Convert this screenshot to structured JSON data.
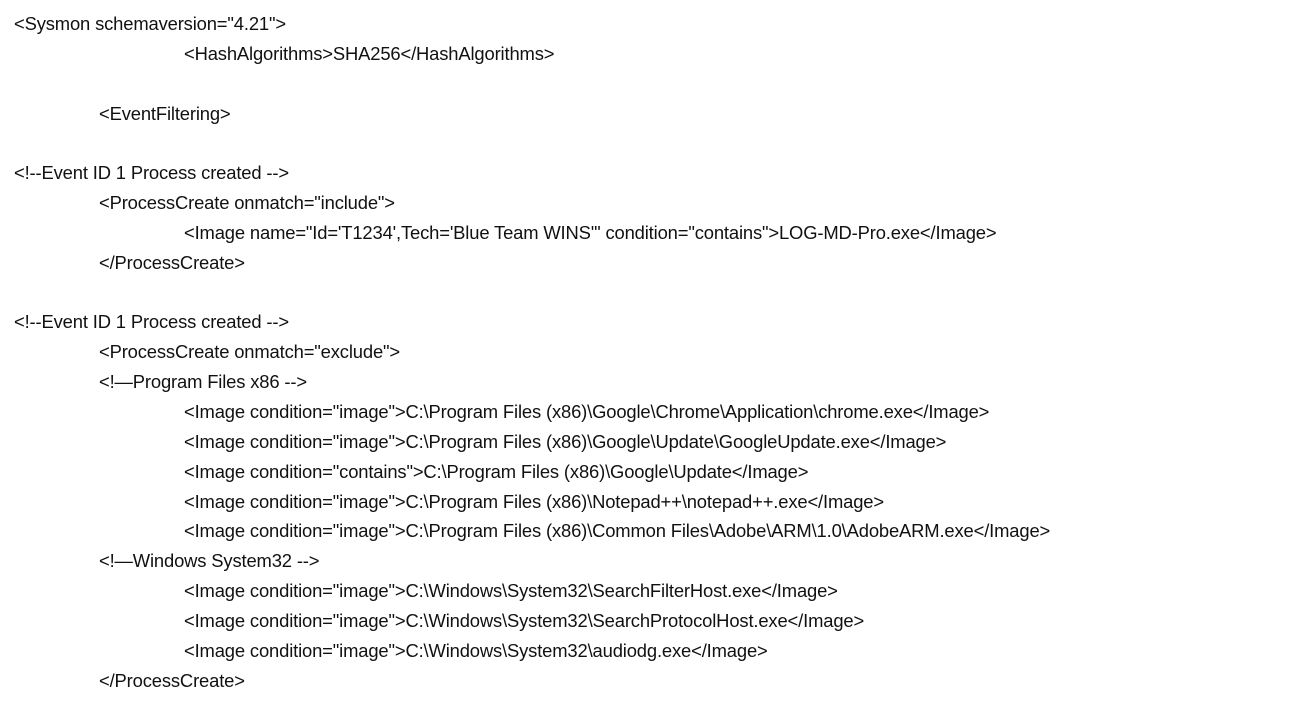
{
  "document": {
    "lines": [
      {
        "indent": 0,
        "text": "<Sysmon schemaversion=\"4.21\">"
      },
      {
        "indent": 2,
        "text": "<HashAlgorithms>SHA256</HashAlgorithms>"
      },
      {
        "indent": 0,
        "text": ""
      },
      {
        "indent": 1,
        "text": "<EventFiltering>"
      },
      {
        "indent": 0,
        "text": ""
      },
      {
        "indent": 0,
        "text": "<!--Event ID 1 Process created -->"
      },
      {
        "indent": 1,
        "text": "<ProcessCreate onmatch=\"include\">"
      },
      {
        "indent": 2,
        "text": "<Image name=\"Id='T1234',Tech='Blue Team WINS'\" condition=\"contains\">LOG-MD-Pro.exe</Image>"
      },
      {
        "indent": 1,
        "text": "</ProcessCreate>"
      },
      {
        "indent": 0,
        "text": ""
      },
      {
        "indent": 0,
        "text": "<!--Event ID 1 Process created -->"
      },
      {
        "indent": 1,
        "text": "<ProcessCreate onmatch=\"exclude\">"
      },
      {
        "indent": 1,
        "text": "<!—Program Files x86 -->"
      },
      {
        "indent": 2,
        "text": "<Image condition=\"image\">C:\\Program Files (x86)\\Google\\Chrome\\Application\\chrome.exe</Image>"
      },
      {
        "indent": 2,
        "text": "<Image condition=\"image\">C:\\Program Files (x86)\\Google\\Update\\GoogleUpdate.exe</Image>"
      },
      {
        "indent": 2,
        "text": "<Image condition=\"contains\">C:\\Program Files (x86)\\Google\\Update</Image>"
      },
      {
        "indent": 2,
        "text": "<Image condition=\"image\">C:\\Program Files (x86)\\Notepad++\\notepad++.exe</Image>"
      },
      {
        "indent": 2,
        "text": "<Image condition=\"image\">C:\\Program Files (x86)\\Common Files\\Adobe\\ARM\\1.0\\AdobeARM.exe</Image>"
      },
      {
        "indent": 1,
        "text": "<!—Windows System32 -->"
      },
      {
        "indent": 2,
        "text": "<Image condition=\"image\">C:\\Windows\\System32\\SearchFilterHost.exe</Image>"
      },
      {
        "indent": 2,
        "text": "<Image condition=\"image\">C:\\Windows\\System32\\SearchProtocolHost.exe</Image>"
      },
      {
        "indent": 2,
        "text": "<Image condition=\"image\">C:\\Windows\\System32\\audiodg.exe</Image>"
      },
      {
        "indent": 1,
        "text": "</ProcessCreate>"
      }
    ]
  }
}
